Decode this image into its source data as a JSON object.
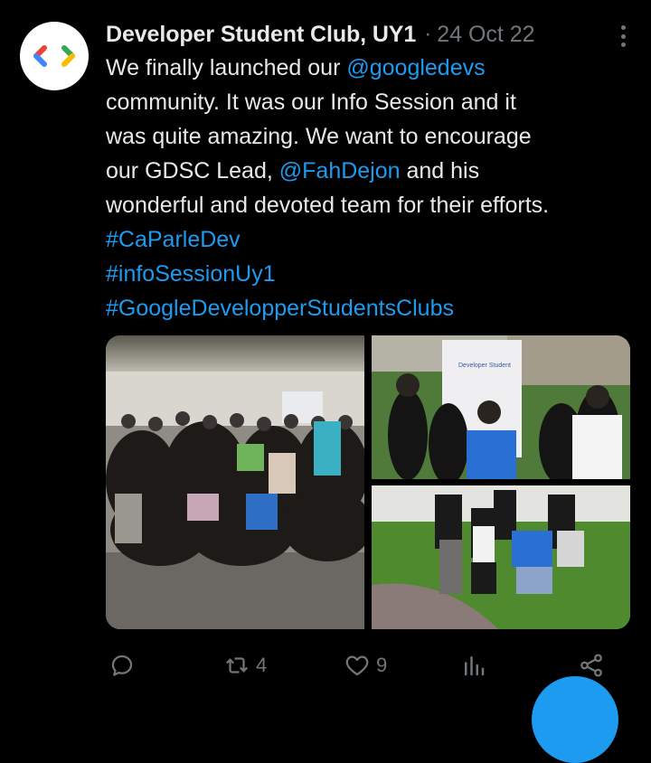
{
  "tweet": {
    "author_name": "Developer Student Club, UY1",
    "separator": "·",
    "date": "24 Oct 22",
    "text_lines": [
      [
        {
          "t": "We finally launched our ",
          "link": false
        },
        {
          "t": "@googledevs",
          "link": true
        }
      ],
      [
        {
          "t": "community. It was our Info Session and it",
          "link": false
        }
      ],
      [
        {
          "t": "was quite amazing. We want to encourage",
          "link": false
        }
      ],
      [
        {
          "t": "our GDSC Lead, ",
          "link": false
        },
        {
          "t": "@FahDejon",
          "link": true
        },
        {
          "t": " and his",
          "link": false
        }
      ],
      [
        {
          "t": "wonderful and devoted team for their efforts.",
          "link": false
        }
      ],
      [
        {
          "t": "#CaParleDev",
          "link": true
        }
      ],
      [
        {
          "t": "#infoSessionUy1",
          "link": true
        }
      ],
      [
        {
          "t": "#GoogleDevelopperStudentsClubs",
          "link": true
        }
      ]
    ],
    "media": [
      {
        "icon": "group-photo",
        "caption": ""
      },
      {
        "icon": "banner-photo",
        "caption": ""
      },
      {
        "icon": "jumping-photo",
        "caption": ""
      }
    ],
    "actions": {
      "reply_icon": "reply-icon",
      "retweet_icon": "retweet-icon",
      "retweet_count": "4",
      "like_icon": "heart-icon",
      "like_count": "9",
      "views_icon": "analytics-icon",
      "share_icon": "share-icon"
    }
  },
  "colors": {
    "background": "#000000",
    "text": "#e7e9ea",
    "muted": "#71767b",
    "link": "#1d9bf0"
  }
}
